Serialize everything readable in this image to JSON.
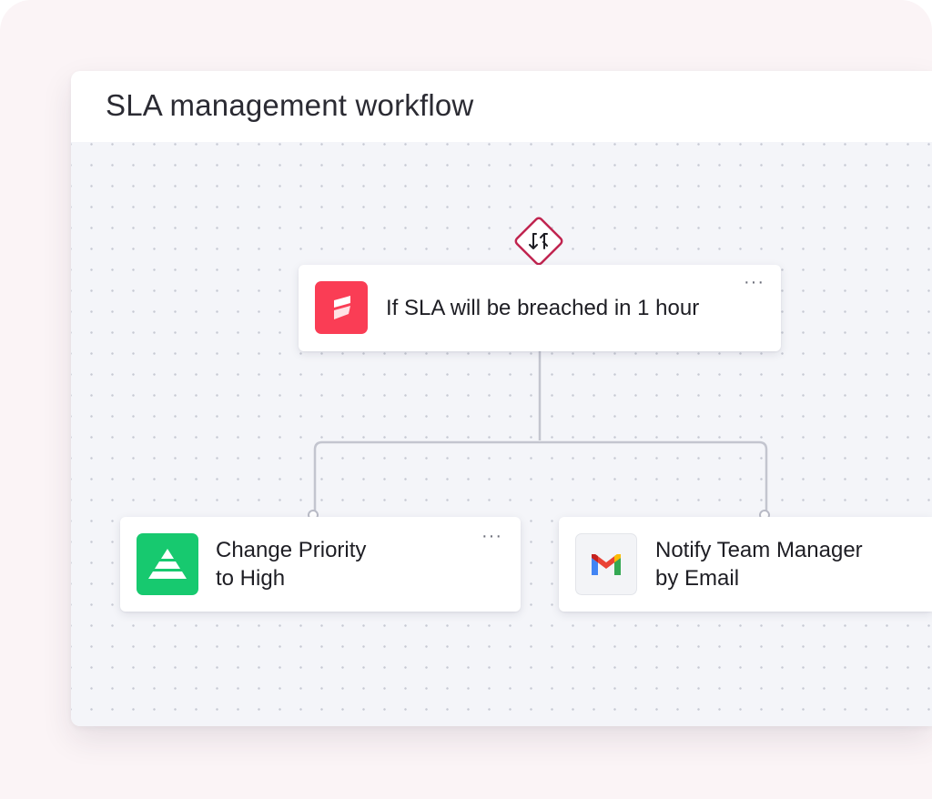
{
  "workflow": {
    "title": "SLA management workflow"
  },
  "trigger": {
    "label": "If SLA will be breached in 1 hour",
    "menu": "···",
    "icon": "sla-app-icon",
    "branch_icon": "swap-arrows-icon",
    "accent": "#fa3d55",
    "diamond_color": "#c0244f"
  },
  "actions": [
    {
      "label_line1": "Change Priority",
      "label_line2": "to High",
      "menu": "···",
      "icon": "priority-pyramid-icon",
      "accent": "#17c96f"
    },
    {
      "label_line1": "Notify Team Manager",
      "label_line2": "by Email",
      "icon": "gmail-icon"
    }
  ]
}
